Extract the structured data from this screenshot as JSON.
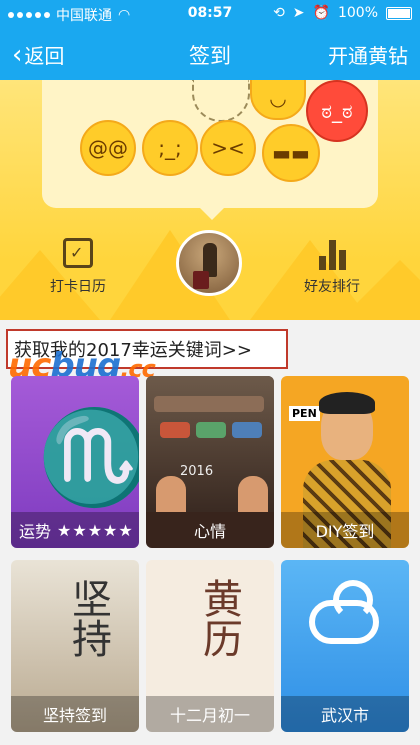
{
  "status_bar": {
    "carrier": "中国联通",
    "time": "08:57",
    "battery": "100%"
  },
  "nav": {
    "back_label": "返回",
    "title": "签到",
    "vip_label": "开通黄钻"
  },
  "banner": {
    "calendar_label": "打卡日历",
    "rank_label": "好友排行"
  },
  "keywords": {
    "link_text": "获取我的2017幸运关键词>>"
  },
  "watermark": {
    "part1": "uc",
    "part2": "bug",
    "part3": ".cc"
  },
  "tiles": [
    {
      "label": "运势",
      "rating": 5,
      "rating_text": "★★★★★",
      "glyph": "♏"
    },
    {
      "label": "心情",
      "sign_text": "2016"
    },
    {
      "label": "DIY签到",
      "pen_text": "PEN"
    },
    {
      "label": "坚持签到",
      "glyph": "坚持"
    },
    {
      "label": "十二月初一",
      "glyph": "黄历"
    },
    {
      "label": "武汉市"
    }
  ],
  "colors": {
    "header_blue": "#1aa8f0",
    "banner_yellow": "#ffd53c",
    "highlight_red": "#c0392b"
  }
}
